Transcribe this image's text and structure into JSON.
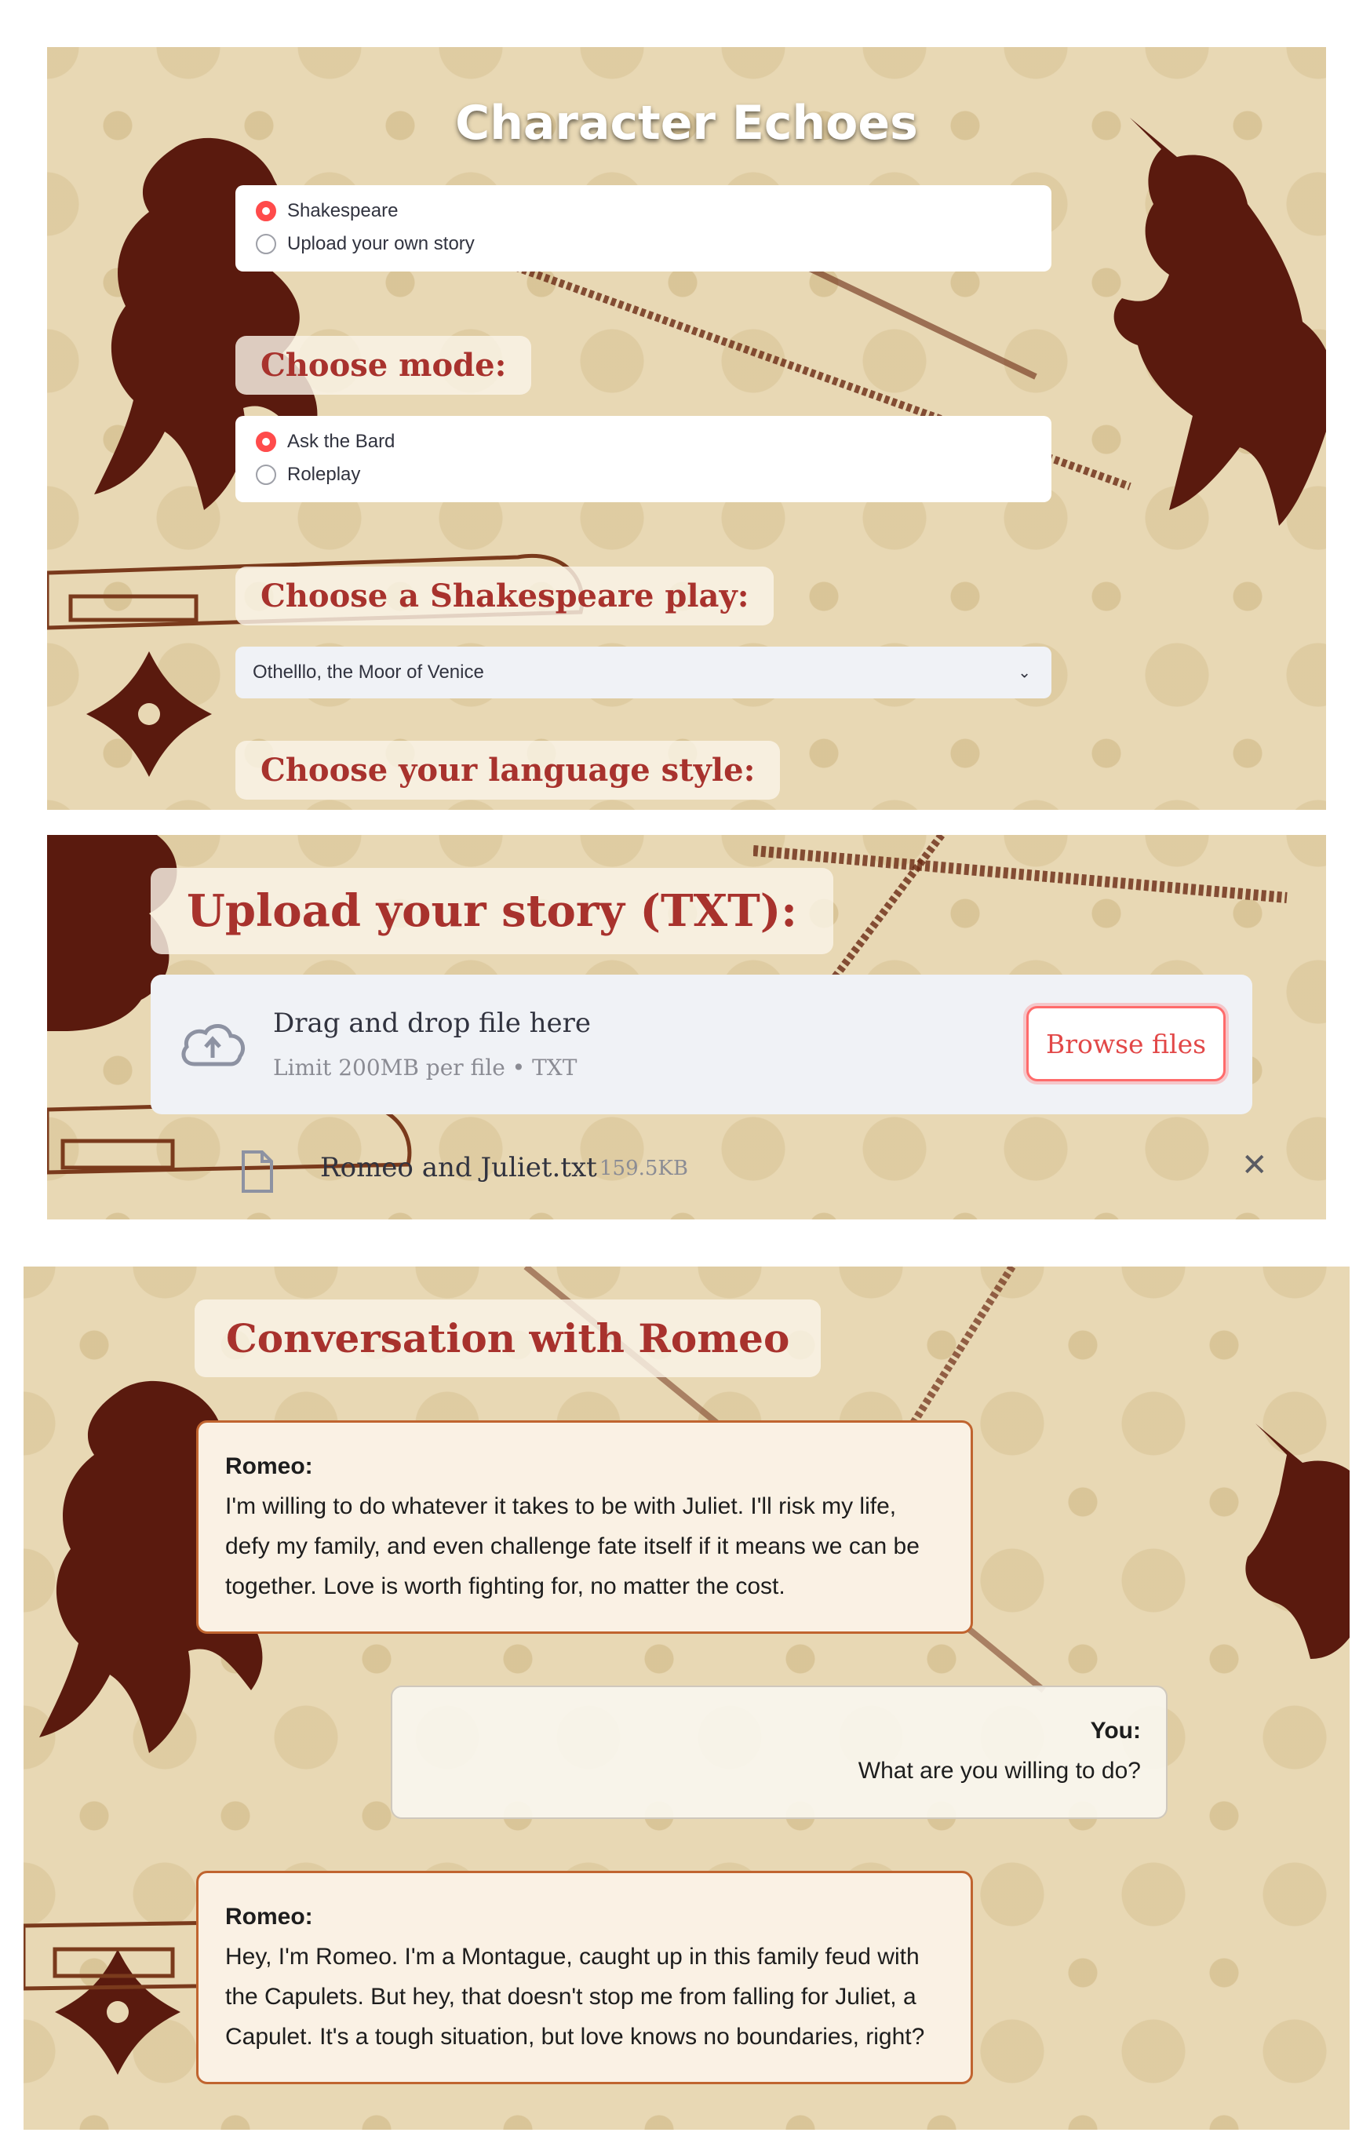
{
  "app": {
    "title": "Character Echoes"
  },
  "source": {
    "options": [
      "Shakespeare",
      "Upload your own story"
    ],
    "selected": "Shakespeare"
  },
  "mode": {
    "heading": "Choose mode:",
    "options": [
      "Ask the Bard",
      "Roleplay"
    ],
    "selected": "Ask the Bard"
  },
  "play": {
    "heading": "Choose a Shakespeare play:",
    "selected": "Othelllo, the Moor of Venice"
  },
  "language": {
    "heading": "Choose your language style:"
  },
  "upload": {
    "heading": "Upload your story (TXT):",
    "drag_text": "Drag and drop file here",
    "limit_text": "Limit 200MB per file • TXT",
    "browse_label": "Browse files",
    "file_name": "Romeo and Juliet.txt",
    "file_size": "159.5KB"
  },
  "conversation": {
    "heading": "Conversation with Romeo",
    "messages": [
      {
        "speaker": "Romeo:",
        "text": "I'm willing to do whatever it takes to be with Juliet. I'll risk my life, defy my family, and even challenge fate itself if it means we can be together. Love is worth fighting for, no matter the cost."
      },
      {
        "speaker": "You:",
        "text": "What are you willing to do?"
      },
      {
        "speaker": "Romeo:",
        "text": "Hey, I'm Romeo. I'm a Montague, caught up in this family feud with the Capulets. But hey, that doesn't stop me from falling for Juliet, a Capulet. It's a tough situation, but love knows no boundaries, right?"
      }
    ]
  },
  "colors": {
    "accent": "#ff4b4b",
    "heading": "#a8322d",
    "ornament": "#5a1a0e",
    "background": "#e8d8b4"
  },
  "icons": [
    "lion-icon",
    "unicorn-icon",
    "cloud-upload-icon",
    "file-icon",
    "close-icon",
    "chevron-down-icon"
  ]
}
